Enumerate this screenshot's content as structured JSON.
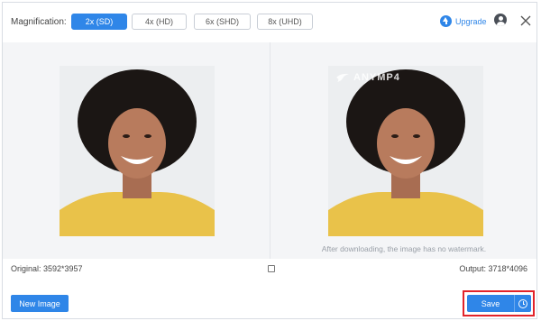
{
  "header": {
    "magnification_label": "Magnification:",
    "options": [
      {
        "label": "2x (SD)",
        "active": true
      },
      {
        "label": "4x (HD)",
        "active": false
      },
      {
        "label": "6x (SHD)",
        "active": false
      },
      {
        "label": "8x (UHD)",
        "active": false
      }
    ],
    "upgrade_label": "Upgrade",
    "upgrade_icon": "arrow-up-circle-icon",
    "user_icon": "user-icon",
    "close_icon": "close-icon"
  },
  "preview": {
    "watermark_text": "ANYMP4",
    "watermark_note": "After downloading, the image has no watermark."
  },
  "info": {
    "original": "Original: 3592*3957",
    "output": "Output: 3718*4096"
  },
  "footer": {
    "new_image_label": "New Image",
    "save_label": "Save",
    "schedule_icon": "clock-icon"
  },
  "colors": {
    "accent": "#2f86e8",
    "highlight_frame": "#e2232a"
  }
}
